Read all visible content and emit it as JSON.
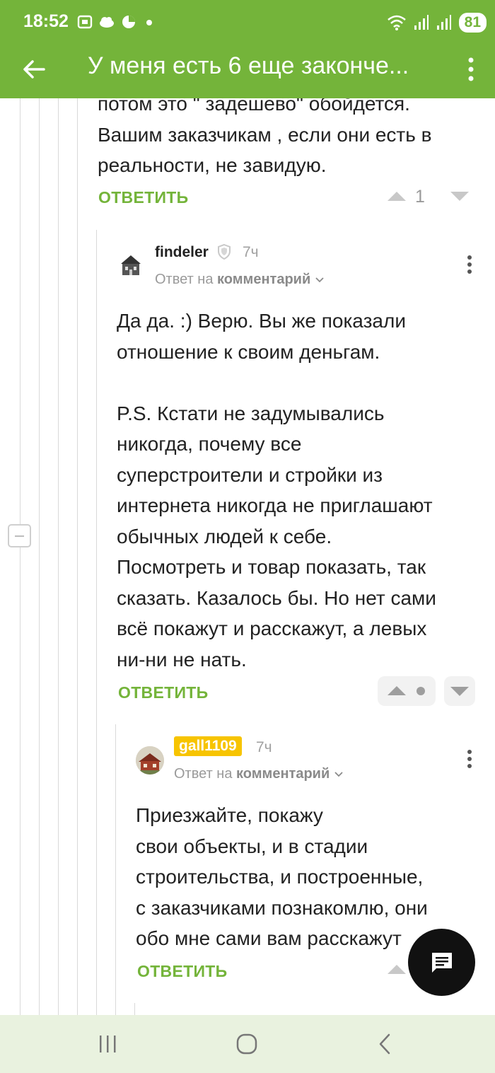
{
  "status_bar": {
    "time": "18:52",
    "battery": "81"
  },
  "toolbar": {
    "title": "У меня есть 6 еще законче..."
  },
  "comment_top": {
    "text": "потом это \" задешево\" обойдется.\nВашим заказчикам , если они есть в\nреальности, не завидую.",
    "reply_label": "ОТВЕТИТЬ",
    "votes": "1"
  },
  "comment_findeler": {
    "username": "findeler",
    "time": "7ч",
    "answer_prefix": "Ответ на",
    "answer_link": "комментарий",
    "text": "Да да. :) Верю. Вы же показали\nотношение к своим деньгам.\n\nP.S. Кстати не задумывались\nникогда, почему все\nсуперстроители и стройки из\nинтернета никогда не приглашают\nобычных людей к себе.\nПосмотреть и товар показать, так\nсказать. Казалось бы. Но нет сами\nвсё покажут и расскажут, а левых\nни-ни не нать.",
    "reply_label": "ОТВЕТИТЬ"
  },
  "comment_gall": {
    "username": "gall1109",
    "time": "7ч",
    "answer_prefix": "Ответ на",
    "answer_link": "комментарий",
    "text": "Приезжайте, покажу\nсвои объекты, и в стадии\nстроительства, и построенные,\nс заказчиками познакомлю, они\nобо мне сами вам расскажут",
    "reply_label": "ОТВЕТИТЬ"
  },
  "colors": {
    "brand": "#74b43a",
    "badge": "#f7c400",
    "nav_bg": "#e9f2df"
  }
}
